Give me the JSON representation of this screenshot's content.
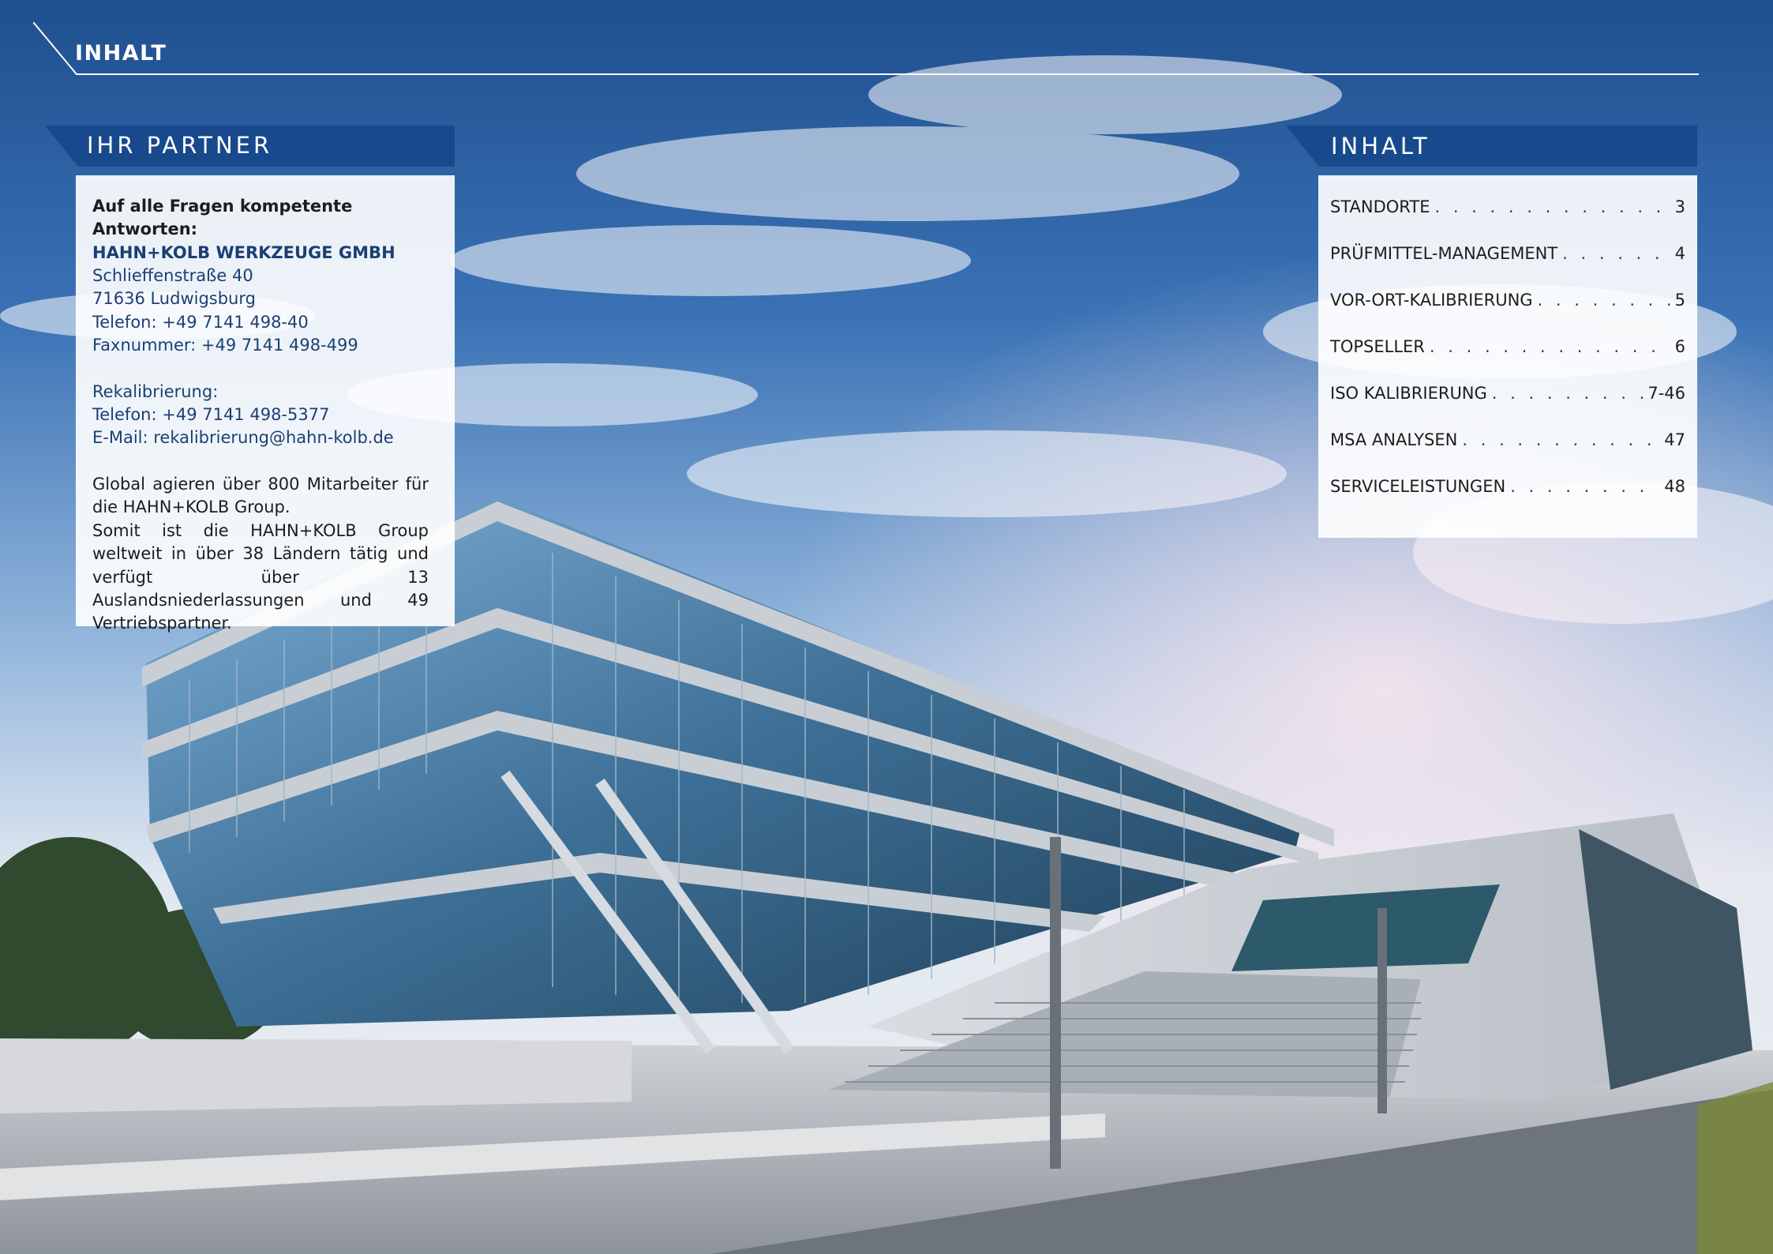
{
  "header": {
    "title": "INHALT"
  },
  "partner": {
    "heading": "IHR PARTNER",
    "intro": "Auf alle Fragen kompetente Antworten:",
    "company": "HAHN+KOLB WERKZEUGE GMBH",
    "street": "Schlieffenstraße 40",
    "city": "71636 Ludwigsburg",
    "phone": "Telefon: +49 7141 498-40",
    "fax": "Faxnummer: +49 7141 498-499",
    "recal_label": "Rekalibrierung:",
    "recal_phone": "Telefon: +49 7141 498-5377",
    "recal_email": "E-Mail: rekalibrierung@hahn-kolb.de",
    "body_1": "Global agieren über 800 Mitarbeiter für die HAHN+KOLB Group.",
    "body_2": "Somit ist die HAHN+KOLB Group weltweit in über 38 Ländern tätig und verfügt über 13 Auslandsniederlassungen und 49 Vertriebspartner."
  },
  "toc": {
    "heading": "INHALT",
    "items": [
      {
        "label": "STANDORTE",
        "page": "3"
      },
      {
        "label": "PRÜFMITTEL-MANAGEMENT",
        "page": "4"
      },
      {
        "label": "VOR-ORT-KALIBRIERUNG",
        "page": "5"
      },
      {
        "label": "TOPSELLER",
        "page": "6"
      },
      {
        "label": "ISO KALIBRIERUNG",
        "page": "7-46"
      },
      {
        "label": "MSA ANALYSEN",
        "page": "47"
      },
      {
        "label": "SERVICELEISTUNGEN",
        "page": "48"
      }
    ]
  },
  "colors": {
    "band": "#17498c",
    "accent_text": "#1c3f73"
  }
}
